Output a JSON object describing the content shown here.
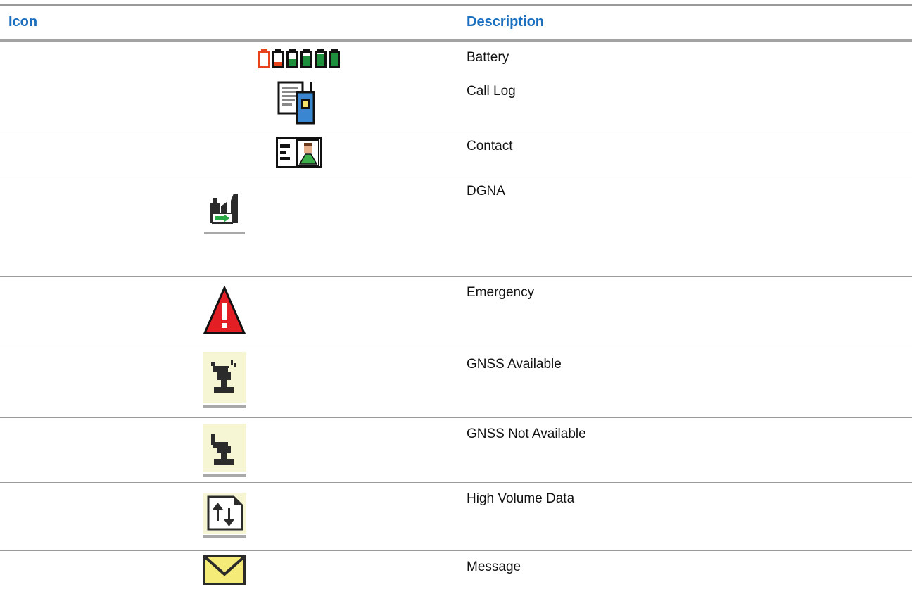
{
  "table": {
    "headers": {
      "icon": "Icon",
      "description": "Description"
    },
    "rows": [
      {
        "icon": "battery-icon",
        "description": "Battery"
      },
      {
        "icon": "call-log-icon",
        "description": "Call Log"
      },
      {
        "icon": "contact-icon",
        "description": "Contact"
      },
      {
        "icon": "dgna-icon",
        "description": "DGNA"
      },
      {
        "icon": "emergency-icon",
        "description": "Emergency"
      },
      {
        "icon": "gnss-available-icon",
        "description": "GNSS Available"
      },
      {
        "icon": "gnss-not-available-icon",
        "description": "GNSS Not Available"
      },
      {
        "icon": "high-volume-data-icon",
        "description": "High Volume Data"
      },
      {
        "icon": "message-icon",
        "description": "Message"
      }
    ]
  },
  "colors": {
    "header_text": "#1a6fbf",
    "battery_red": "#e8421a",
    "battery_green": "#1e8f3c",
    "call_log_blue": "#3a86d0",
    "emergency_red": "#e31e24",
    "gnss_bg": "#f6f6d4",
    "message_yellow": "#f4eb78"
  }
}
